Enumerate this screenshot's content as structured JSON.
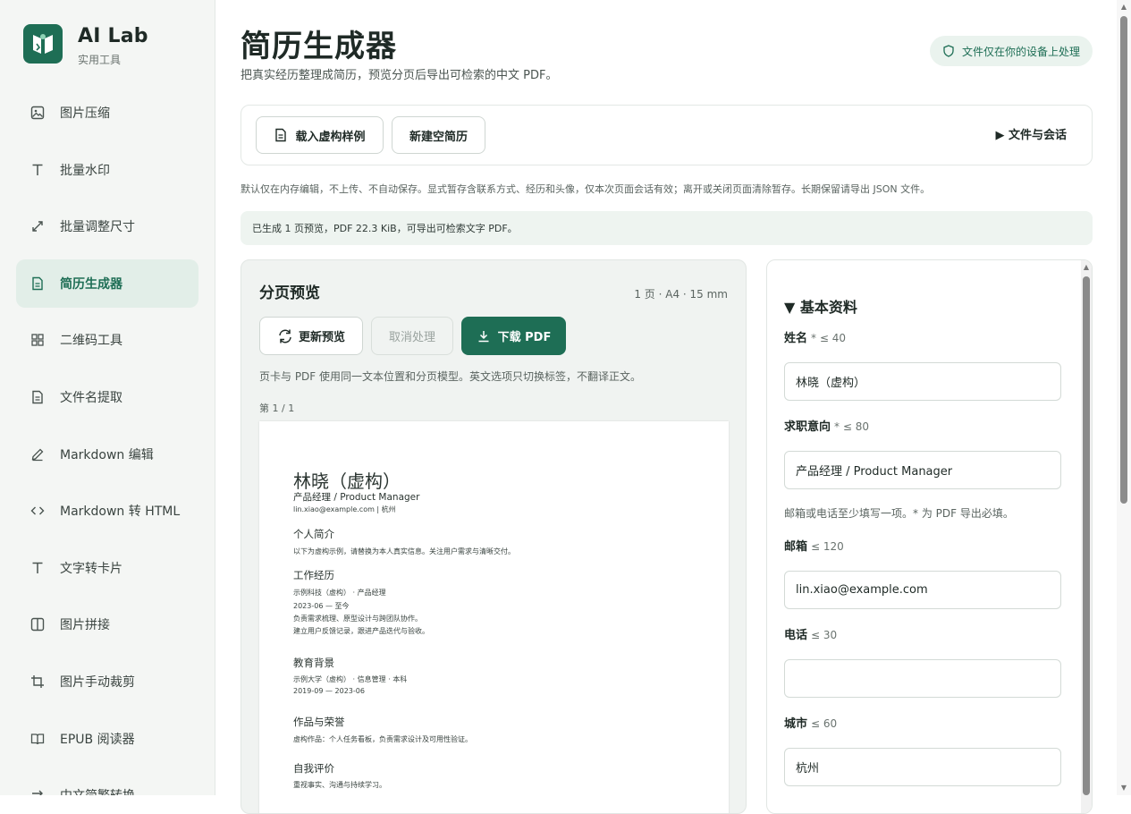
{
  "brand": {
    "title": "AI Lab",
    "subtitle": "实用工具"
  },
  "sidebar": {
    "items": [
      {
        "label": "图片压缩",
        "icon": "image-icon"
      },
      {
        "label": "批量水印",
        "icon": "text-t-icon"
      },
      {
        "label": "批量调整尺寸",
        "icon": "resize-icon"
      },
      {
        "label": "简历生成器",
        "icon": "document-icon",
        "active": true
      },
      {
        "label": "二维码工具",
        "icon": "grid-icon"
      },
      {
        "label": "文件名提取",
        "icon": "document-icon"
      },
      {
        "label": "Markdown 编辑",
        "icon": "pencil-icon"
      },
      {
        "label": "Markdown 转 HTML",
        "icon": "code-icon"
      },
      {
        "label": "文字转卡片",
        "icon": "text-t-icon"
      },
      {
        "label": "图片拼接",
        "icon": "columns-icon"
      },
      {
        "label": "图片手动裁剪",
        "icon": "crop-icon"
      },
      {
        "label": "EPUB 阅读器",
        "icon": "book-icon"
      },
      {
        "label": "中文简繁转换",
        "icon": "arrow-icon"
      }
    ]
  },
  "header": {
    "title": "简历生成器",
    "subtitle": "把真实经历整理成简历，预览分页后导出可检索的中文 PDF。",
    "privacy": "文件仅在你的设备上处理"
  },
  "toolbar": {
    "load_sample": "载入虚构样例",
    "new_blank": "新建空简历",
    "files_toggle": "▶ 文件与会话"
  },
  "note": "默认仅在内存编辑，不上传、不自动保存。显式暂存含联系方式、经历和头像，仅本次页面会话有效；离开或关闭页面清除暂存。长期保留请导出 JSON 文件。",
  "status": "已生成 1 页预览，PDF 22.3 KiB，可导出可检索文字 PDF。",
  "preview": {
    "title": "分页预览",
    "meta": "1 页 · A4 · 15 mm",
    "refresh": "更新预览",
    "cancel": "取消处理",
    "download": "下载 PDF",
    "hint": "页卡与 PDF 使用同一文本位置和分页模型。英文选项只切换标签，不翻译正文。",
    "page_label": "第 1 / 1",
    "resume": {
      "name": "林晓（虚构）",
      "role": "产品经理 / Product Manager",
      "contact": "lin.xiao@example.com | 杭州",
      "summary_h": "个人简介",
      "summary": "以下为虚构示例，请替换为本人真实信息。关注用户需求与清晰交付。",
      "work_h": "工作经历",
      "work_1": "示例科技（虚构） · 产品经理",
      "work_2": "2023-06 — 至今",
      "work_3": "负责需求梳理、原型设计与跨团队协作。",
      "work_4": "建立用户反馈记录，跟进产品迭代与验收。",
      "edu_h": "教育背景",
      "edu_1": "示例大学（虚构） · 信息管理 · 本科",
      "edu_2": "2019-09 — 2023-06",
      "award_h": "作品与荣誉",
      "award_1": "虚构作品：个人任务看板，负责需求设计及可用性验证。",
      "self_h": "自我评价",
      "self_1": "重视事实、沟通与持续学习。"
    }
  },
  "form": {
    "section": "▼ 基本资料",
    "name_label": "姓名",
    "name_limit": "* ≤ 40",
    "name_value": "林晓（虚构）",
    "intent_label": "求职意向",
    "intent_limit": "* ≤ 80",
    "intent_value": "产品经理 / Product Manager",
    "contact_hint": "邮箱或电话至少填写一项。* 为 PDF 导出必填。",
    "email_label": "邮箱",
    "email_limit": "≤ 120",
    "email_value": "lin.xiao@example.com",
    "phone_label": "电话",
    "phone_limit": "≤ 30",
    "phone_value": "",
    "city_label": "城市",
    "city_limit": "≤ 60",
    "city_value": "杭州"
  },
  "colors": {
    "accent": "#1e6e55",
    "active_bg": "#e2eee8",
    "sidebar_bg": "#f4f6f4"
  }
}
